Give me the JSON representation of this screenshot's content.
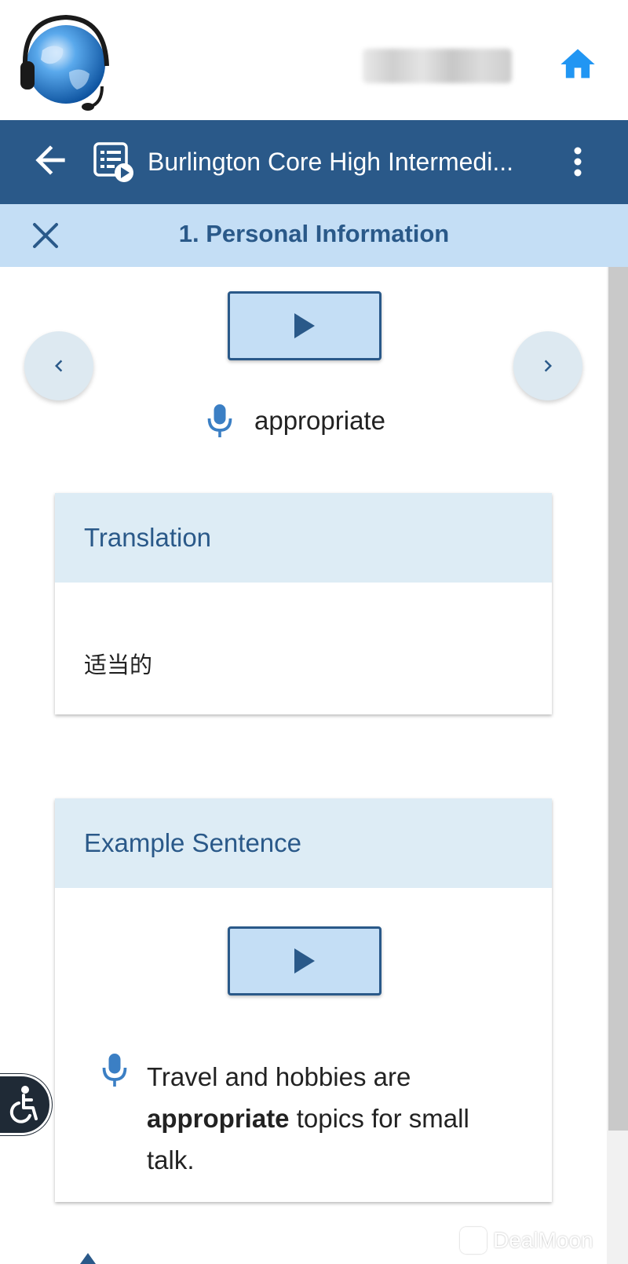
{
  "header": {
    "logo_icon": "globe-headset-logo",
    "user_name_blurred": "",
    "home_icon": "home-icon",
    "accent_color": "#2196f3"
  },
  "navbar": {
    "back_icon": "arrow-left-icon",
    "lesson_icon": "lesson-playlist-icon",
    "course_title": "Burlington Core High Intermedi...",
    "menu_icon": "more-vertical-icon",
    "background_color": "#2a5989"
  },
  "section": {
    "close_icon": "close-icon",
    "title": "1. Personal Information",
    "background_color": "#c4def5"
  },
  "flashcard": {
    "play_icon": "play-icon",
    "prev_icon": "chevron-left-icon",
    "next_icon": "chevron-right-icon",
    "mic_icon": "microphone-icon",
    "word": "appropriate"
  },
  "translation_card": {
    "header": "Translation",
    "text": "适当的"
  },
  "example_card": {
    "header": "Example Sentence",
    "play_icon": "play-icon",
    "mic_icon": "microphone-icon",
    "sentence_before": "Travel and hobbies are ",
    "sentence_bold": "appropriate",
    "sentence_after": " topics for small talk."
  },
  "accessibility": {
    "icon": "accessibility-icon"
  },
  "watermark": {
    "text": "DealMoon"
  }
}
